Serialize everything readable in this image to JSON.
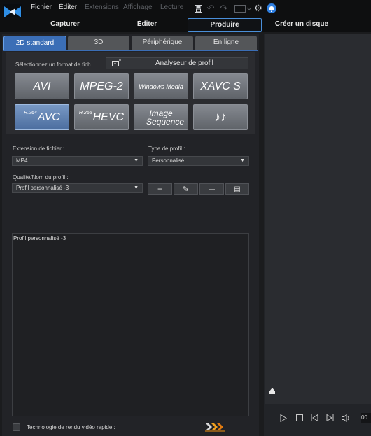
{
  "menubar": {
    "menus": [
      "Fichier",
      "Éditer",
      "Extensions",
      "Affichage",
      "Lecture"
    ]
  },
  "modes": {
    "capture": "Capturer",
    "edit": "Éditer",
    "produce": "Produire",
    "disc": "Créer un disque"
  },
  "subtabs": [
    "2D standard",
    "3D",
    "Périphérique",
    "En ligne"
  ],
  "format": {
    "prompt": "Sélectionnez un format de fich...",
    "analyzer": "Analyseur de profil",
    "buttons": {
      "avi": "AVI",
      "mpeg2": "MPEG-2",
      "wmv": "Windows Media",
      "xavc": "XAVC S",
      "avc_sup": "H.264",
      "avc": "AVC",
      "hevc_sup": "H.265",
      "hevc": "HEVC",
      "image_seq_1": "Image",
      "image_seq_2": "Sequence",
      "audio": "♪♪"
    },
    "selected": "AVC"
  },
  "file_extension": {
    "label": "Extension de fichier :",
    "value": "MP4"
  },
  "profile_type": {
    "label": "Type de profil :",
    "value": "Personnalisé"
  },
  "quality": {
    "label": "Qualité/Nom du profil :",
    "value": "Profil personnalisé -3"
  },
  "profile_actions": {
    "add": "+",
    "edit": "✎",
    "remove": "—",
    "details": "▤"
  },
  "description": "Profil personnalisé -3",
  "fast_render": {
    "label": "Technologie de rendu vidéo rapide :",
    "checked": false
  },
  "player": {
    "timecode": "00"
  },
  "colors": {
    "accent": "#3b6eb6",
    "selected_format": "#5a7fb5",
    "background": "#1b1c1e"
  }
}
